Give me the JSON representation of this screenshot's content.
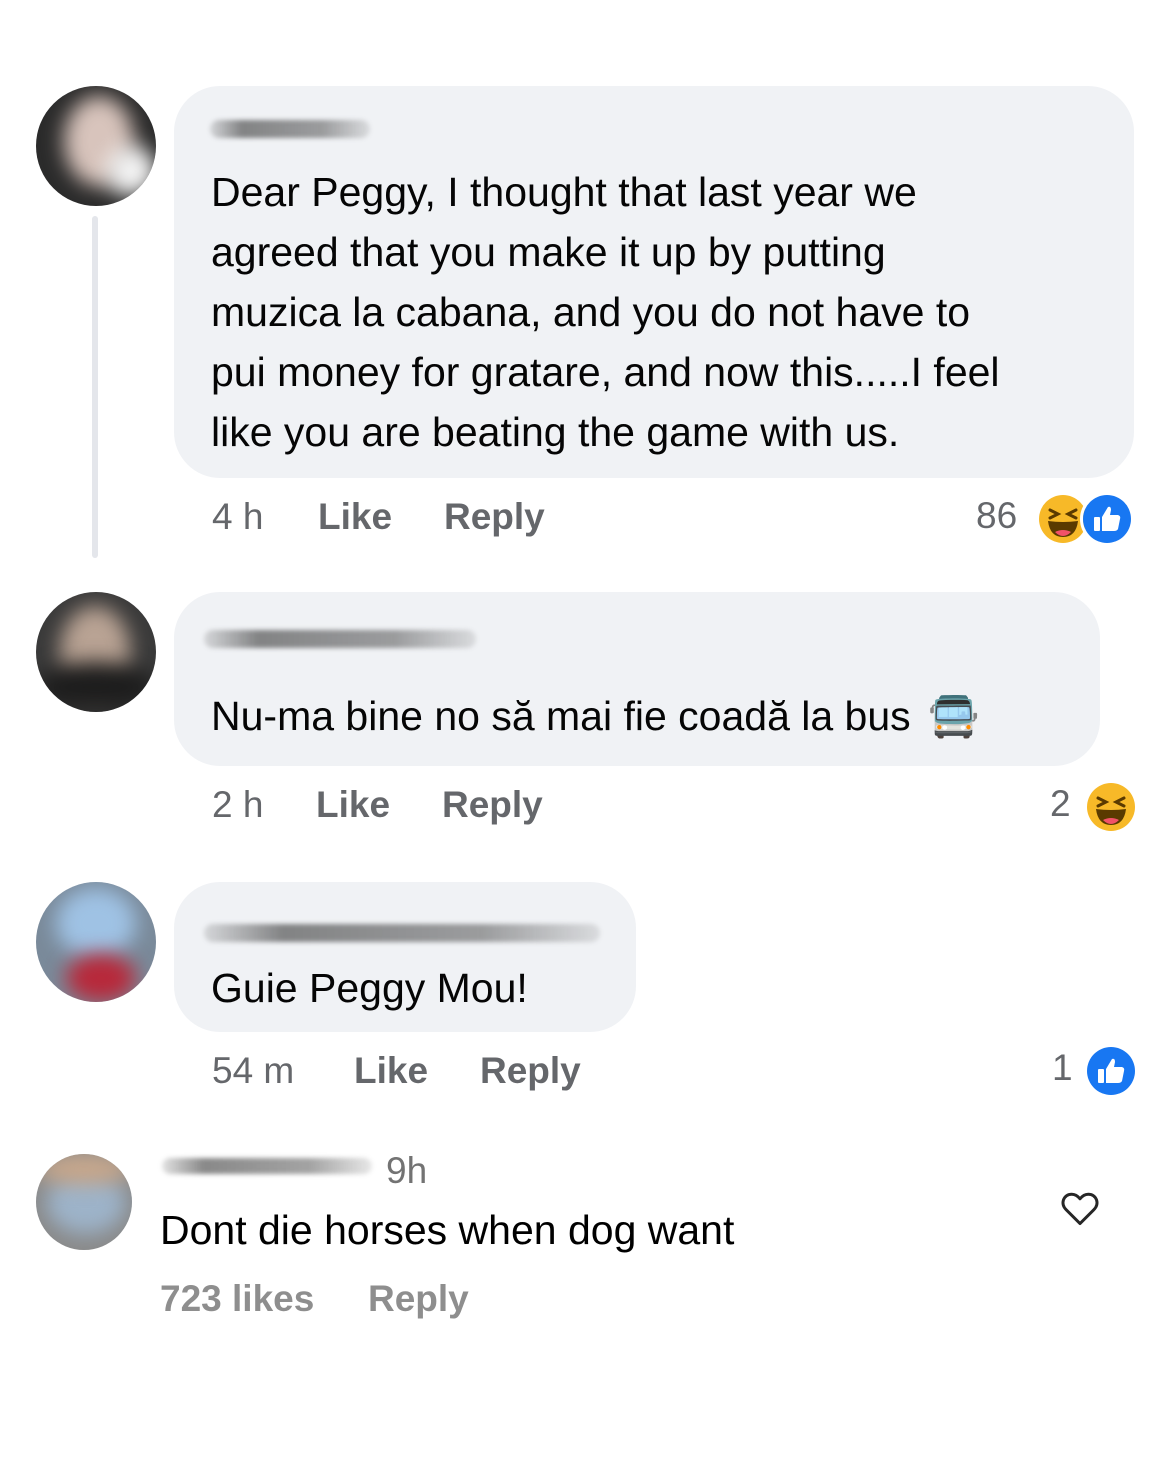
{
  "comments": [
    {
      "text": "Dear Peggy, I thought that last year we\nagreed that you make it up by putting\nmuzica la cabana, and you do not have to\npui money for gratare, and now this.....I feel\nlike you are beating the game with us.",
      "time": "4 h",
      "like_label": "Like",
      "reply_label": "Reply",
      "reaction_count": "86",
      "reactions": [
        "haha-icon",
        "like-icon"
      ]
    },
    {
      "text": "Nu-ma bine no să mai fie coadă la bus",
      "emoji": "🚍",
      "time": "2 h",
      "like_label": "Like",
      "reply_label": "Reply",
      "reaction_count": "2",
      "reactions": [
        "haha-icon"
      ]
    },
    {
      "text": "Guie Peggy Mou!",
      "time": "54 m",
      "like_label": "Like",
      "reply_label": "Reply",
      "reaction_count": "1",
      "reactions": [
        "like-icon"
      ]
    }
  ],
  "ig_comment": {
    "time": "9h",
    "text": "Dont die horses when dog want",
    "likes": "723 likes",
    "reply_label": "Reply",
    "icon": "heart-outline-icon"
  },
  "colors": {
    "bubble": "#f0f2f5",
    "meta": "#65676b",
    "like_blue": "#1877f2",
    "haha_yellow": "#f7b928"
  }
}
